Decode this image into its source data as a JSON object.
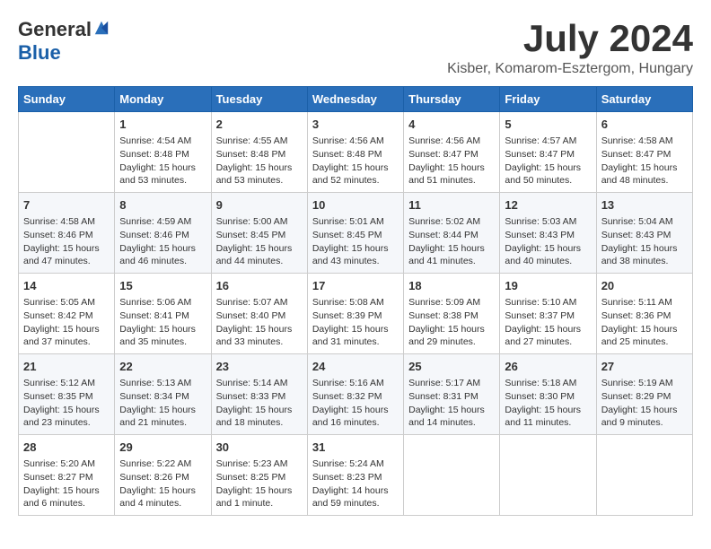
{
  "header": {
    "logo_general": "General",
    "logo_blue": "Blue",
    "month_title": "July 2024",
    "location": "Kisber, Komarom-Esztergom, Hungary"
  },
  "weekdays": [
    "Sunday",
    "Monday",
    "Tuesday",
    "Wednesday",
    "Thursday",
    "Friday",
    "Saturday"
  ],
  "weeks": [
    [
      {
        "day": "",
        "content": ""
      },
      {
        "day": "1",
        "content": "Sunrise: 4:54 AM\nSunset: 8:48 PM\nDaylight: 15 hours\nand 53 minutes."
      },
      {
        "day": "2",
        "content": "Sunrise: 4:55 AM\nSunset: 8:48 PM\nDaylight: 15 hours\nand 53 minutes."
      },
      {
        "day": "3",
        "content": "Sunrise: 4:56 AM\nSunset: 8:48 PM\nDaylight: 15 hours\nand 52 minutes."
      },
      {
        "day": "4",
        "content": "Sunrise: 4:56 AM\nSunset: 8:47 PM\nDaylight: 15 hours\nand 51 minutes."
      },
      {
        "day": "5",
        "content": "Sunrise: 4:57 AM\nSunset: 8:47 PM\nDaylight: 15 hours\nand 50 minutes."
      },
      {
        "day": "6",
        "content": "Sunrise: 4:58 AM\nSunset: 8:47 PM\nDaylight: 15 hours\nand 48 minutes."
      }
    ],
    [
      {
        "day": "7",
        "content": "Sunrise: 4:58 AM\nSunset: 8:46 PM\nDaylight: 15 hours\nand 47 minutes."
      },
      {
        "day": "8",
        "content": "Sunrise: 4:59 AM\nSunset: 8:46 PM\nDaylight: 15 hours\nand 46 minutes."
      },
      {
        "day": "9",
        "content": "Sunrise: 5:00 AM\nSunset: 8:45 PM\nDaylight: 15 hours\nand 44 minutes."
      },
      {
        "day": "10",
        "content": "Sunrise: 5:01 AM\nSunset: 8:45 PM\nDaylight: 15 hours\nand 43 minutes."
      },
      {
        "day": "11",
        "content": "Sunrise: 5:02 AM\nSunset: 8:44 PM\nDaylight: 15 hours\nand 41 minutes."
      },
      {
        "day": "12",
        "content": "Sunrise: 5:03 AM\nSunset: 8:43 PM\nDaylight: 15 hours\nand 40 minutes."
      },
      {
        "day": "13",
        "content": "Sunrise: 5:04 AM\nSunset: 8:43 PM\nDaylight: 15 hours\nand 38 minutes."
      }
    ],
    [
      {
        "day": "14",
        "content": "Sunrise: 5:05 AM\nSunset: 8:42 PM\nDaylight: 15 hours\nand 37 minutes."
      },
      {
        "day": "15",
        "content": "Sunrise: 5:06 AM\nSunset: 8:41 PM\nDaylight: 15 hours\nand 35 minutes."
      },
      {
        "day": "16",
        "content": "Sunrise: 5:07 AM\nSunset: 8:40 PM\nDaylight: 15 hours\nand 33 minutes."
      },
      {
        "day": "17",
        "content": "Sunrise: 5:08 AM\nSunset: 8:39 PM\nDaylight: 15 hours\nand 31 minutes."
      },
      {
        "day": "18",
        "content": "Sunrise: 5:09 AM\nSunset: 8:38 PM\nDaylight: 15 hours\nand 29 minutes."
      },
      {
        "day": "19",
        "content": "Sunrise: 5:10 AM\nSunset: 8:37 PM\nDaylight: 15 hours\nand 27 minutes."
      },
      {
        "day": "20",
        "content": "Sunrise: 5:11 AM\nSunset: 8:36 PM\nDaylight: 15 hours\nand 25 minutes."
      }
    ],
    [
      {
        "day": "21",
        "content": "Sunrise: 5:12 AM\nSunset: 8:35 PM\nDaylight: 15 hours\nand 23 minutes."
      },
      {
        "day": "22",
        "content": "Sunrise: 5:13 AM\nSunset: 8:34 PM\nDaylight: 15 hours\nand 21 minutes."
      },
      {
        "day": "23",
        "content": "Sunrise: 5:14 AM\nSunset: 8:33 PM\nDaylight: 15 hours\nand 18 minutes."
      },
      {
        "day": "24",
        "content": "Sunrise: 5:16 AM\nSunset: 8:32 PM\nDaylight: 15 hours\nand 16 minutes."
      },
      {
        "day": "25",
        "content": "Sunrise: 5:17 AM\nSunset: 8:31 PM\nDaylight: 15 hours\nand 14 minutes."
      },
      {
        "day": "26",
        "content": "Sunrise: 5:18 AM\nSunset: 8:30 PM\nDaylight: 15 hours\nand 11 minutes."
      },
      {
        "day": "27",
        "content": "Sunrise: 5:19 AM\nSunset: 8:29 PM\nDaylight: 15 hours\nand 9 minutes."
      }
    ],
    [
      {
        "day": "28",
        "content": "Sunrise: 5:20 AM\nSunset: 8:27 PM\nDaylight: 15 hours\nand 6 minutes."
      },
      {
        "day": "29",
        "content": "Sunrise: 5:22 AM\nSunset: 8:26 PM\nDaylight: 15 hours\nand 4 minutes."
      },
      {
        "day": "30",
        "content": "Sunrise: 5:23 AM\nSunset: 8:25 PM\nDaylight: 15 hours\nand 1 minute."
      },
      {
        "day": "31",
        "content": "Sunrise: 5:24 AM\nSunset: 8:23 PM\nDaylight: 14 hours\nand 59 minutes."
      },
      {
        "day": "",
        "content": ""
      },
      {
        "day": "",
        "content": ""
      },
      {
        "day": "",
        "content": ""
      }
    ]
  ]
}
